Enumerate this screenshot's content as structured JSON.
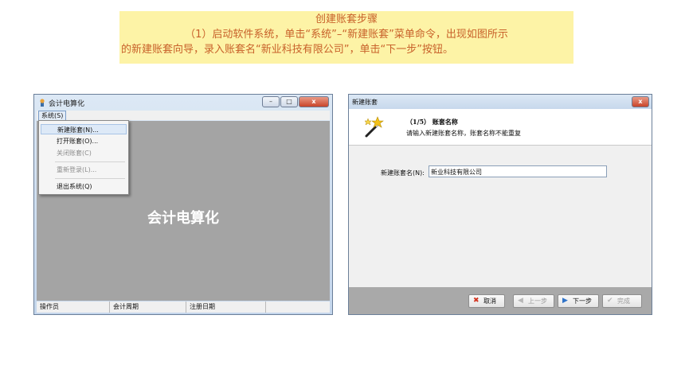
{
  "banner": {
    "title": "创建账套步骤",
    "line1": "（1）启动软件系统，单击“系统”–“新建账套”菜单命令，出现如图所示",
    "line2": "的新建账套向导，录入账套名“新业科技有限公司”，单击“下一步”按钮。"
  },
  "main_window": {
    "title": "会计电算化",
    "controls": {
      "minimize": "–",
      "maximize": "□",
      "close": "x"
    },
    "menu": {
      "system": "系统(S)"
    },
    "dropdown": {
      "items": [
        {
          "label": "新建账套(N)...",
          "state": "highlighted"
        },
        {
          "label": "打开账套(O)...",
          "state": "enabled"
        },
        {
          "label": "关闭账套(C)",
          "state": "disabled"
        },
        {
          "label": "重新登录(L)...",
          "state": "disabled"
        },
        {
          "label": "退出系统(Q)",
          "state": "enabled"
        }
      ]
    },
    "center_text": "会计电算化",
    "status": {
      "operator": "操作员",
      "period": "会计周期",
      "date": "注册日期"
    }
  },
  "wizard": {
    "title": "新建账套",
    "close": "x",
    "step_title": "（1/5） 账套名称",
    "step_desc": "请输入新建账套名称，账套名称不能重复",
    "field_label": "新建账套名(N):",
    "field_value": "新业科技有限公司",
    "buttons": {
      "cancel": "取消",
      "prev": "上一步",
      "next": "下一步",
      "finish": "完成"
    }
  },
  "colors": {
    "banner_bg": "#fdf3a6",
    "banner_text": "#c8612a",
    "client_gray": "#a4a4a4",
    "footer_gray": "#a9a9a9"
  }
}
